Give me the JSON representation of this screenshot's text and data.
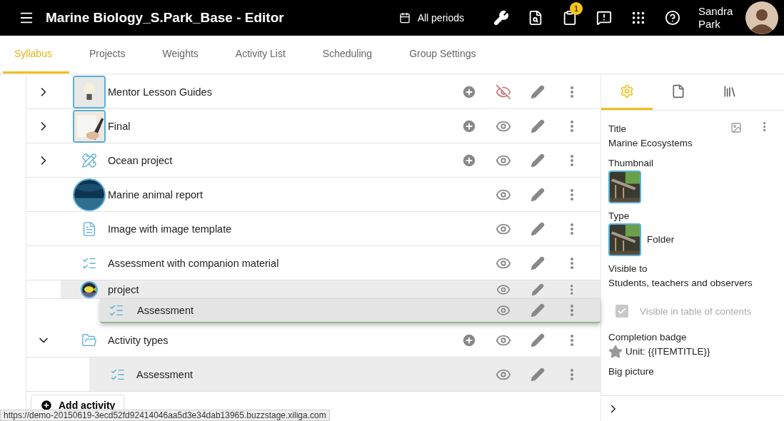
{
  "header": {
    "title": "Marine Biology_S.Park_Base - Editor",
    "period": "All periods",
    "notification_count": "1",
    "user_name": "Sandra Park"
  },
  "tabs": [
    {
      "label": "Syllabus",
      "selected": true
    },
    {
      "label": "Projects",
      "selected": false
    },
    {
      "label": "Weights",
      "selected": false
    },
    {
      "label": "Activity List",
      "selected": false
    },
    {
      "label": "Scheduling",
      "selected": false
    },
    {
      "label": "Group Settings",
      "selected": false
    }
  ],
  "rows": [
    {
      "title": "Mentor Lesson Guides",
      "kind": "picture",
      "expandable": true,
      "expanded": false,
      "add": true,
      "visible": false,
      "shaded": false,
      "partly_covered": false
    },
    {
      "title": "Final",
      "kind": "picture",
      "expandable": true,
      "expanded": false,
      "add": true,
      "visible": true,
      "shaded": false,
      "partly_covered": false
    },
    {
      "title": "Ocean project",
      "kind": "project",
      "expandable": true,
      "expanded": false,
      "add": true,
      "visible": true,
      "shaded": false,
      "partly_covered": false
    },
    {
      "title": "Marine animal report",
      "kind": "picture",
      "expandable": false,
      "add": false,
      "visible": true,
      "shaded": false,
      "partly_covered": false
    },
    {
      "title": "Image with image template",
      "kind": "page",
      "expandable": false,
      "add": false,
      "visible": true,
      "shaded": false,
      "partly_covered": false
    },
    {
      "title": "Assessment with companion material",
      "kind": "assessment",
      "expandable": false,
      "add": false,
      "visible": true,
      "shaded": false,
      "partly_covered": false
    },
    {
      "title": "project",
      "kind": "picture",
      "expandable": false,
      "add": false,
      "visible": true,
      "shaded": true,
      "partly_covered": true
    },
    {
      "title": "Activity types",
      "kind": "folder",
      "expandable": true,
      "expanded": true,
      "add": true,
      "visible": true,
      "shaded": false,
      "partly_covered": false,
      "children": [
        {
          "title": "Assessment",
          "kind": "assessment",
          "expandable": false,
          "add": false,
          "visible": true,
          "shaded": true,
          "partly_covered": false
        }
      ]
    }
  ],
  "drag_item": {
    "title": "Assessment",
    "kind": "assessment"
  },
  "add_button": "Add activity",
  "status_url": "https://demo-20150619-3ecd52fd92414046aa5d3e34dab13965.buzzstage.xiliga.com",
  "panel": {
    "tabs": [
      {
        "selected": true
      },
      {
        "selected": false
      },
      {
        "selected": false
      }
    ],
    "title_label": "Title",
    "title_value": "Marine Ecosystems",
    "thumbnail_label": "Thumbnail",
    "type_label": "Type",
    "type_value": "Folder",
    "visible_label": "Visible to",
    "visible_value": "Students, teachers and observers",
    "toc": {
      "label": "Visible in table of contents",
      "checked": true,
      "disabled": true
    },
    "badge_label": "Completion badge",
    "badge_value": "Unit: {{ITEMTITLE}}",
    "big_picture_label": "Big picture"
  }
}
